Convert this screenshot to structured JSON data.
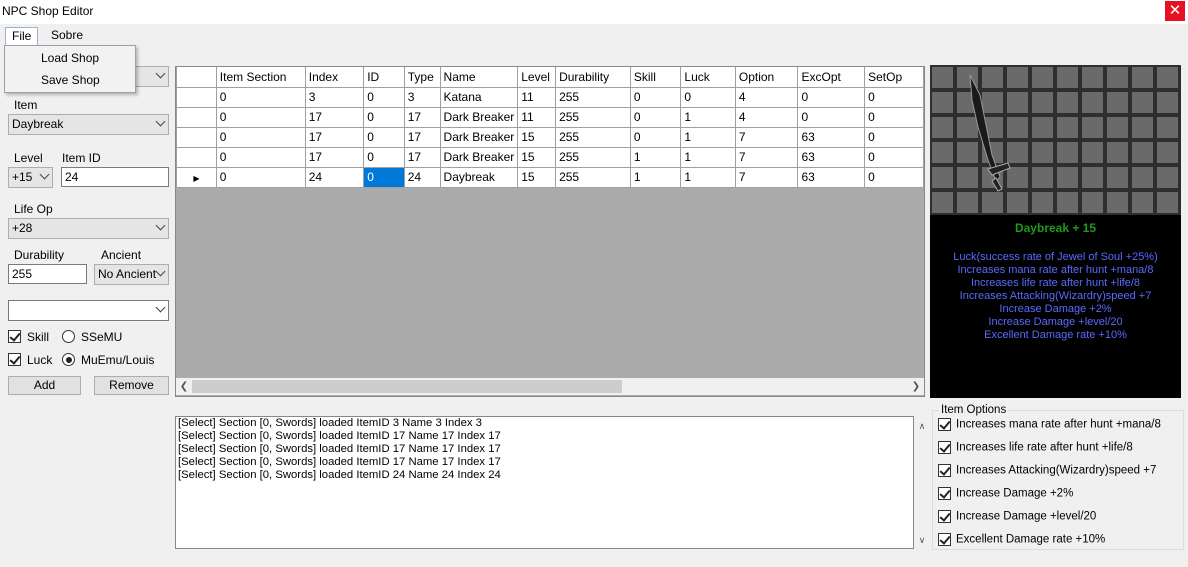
{
  "window": {
    "title": "NPC Shop Editor",
    "close_glyph": "✕"
  },
  "menu": {
    "file": "File",
    "sobre": "Sobre",
    "file_items": [
      "Load Shop",
      "Save Shop"
    ]
  },
  "left": {
    "item_label": "Item",
    "item_value": "Daybreak",
    "level_label": "Level",
    "level_value": "+15",
    "item_id_label": "Item ID",
    "item_id_value": "24",
    "life_op_label": "Life Op",
    "life_op_value": "+28",
    "durability_label": "Durability",
    "durability_value": "255",
    "ancient_label": "Ancient",
    "ancient_value": "No Ancient",
    "empty_combo_value": "",
    "skill_label": "Skill",
    "skill_checked": true,
    "luck_label": "Luck",
    "luck_checked": true,
    "radio_ssemu": "SSeMU",
    "radio_muemu": "MuEmu/Louis",
    "selected_radio": "MuEmu/Louis",
    "add_button": "Add",
    "remove_button": "Remove"
  },
  "grid": {
    "columns": [
      "Item Section",
      "Index",
      "ID",
      "Type",
      "Name",
      "Level",
      "Durability",
      "Skill",
      "Luck",
      "Option",
      "ExcOpt",
      "SetOp"
    ],
    "rows": [
      [
        "0",
        "3",
        "0",
        "3",
        "Katana",
        "11",
        "255",
        "0",
        "0",
        "4",
        "0",
        "0"
      ],
      [
        "0",
        "17",
        "0",
        "17",
        "Dark Breaker",
        "11",
        "255",
        "0",
        "1",
        "4",
        "0",
        "0"
      ],
      [
        "0",
        "17",
        "0",
        "17",
        "Dark Breaker",
        "15",
        "255",
        "0",
        "1",
        "7",
        "63",
        "0"
      ],
      [
        "0",
        "17",
        "0",
        "17",
        "Dark Breaker",
        "15",
        "255",
        "1",
        "1",
        "7",
        "63",
        "0"
      ],
      [
        "0",
        "24",
        "0",
        "24",
        "Daybreak",
        "15",
        "255",
        "1",
        "1",
        "7",
        "63",
        "0"
      ]
    ],
    "current_row": 4,
    "selected_cell": [
      4,
      2
    ],
    "row_pointer_glyph": "▶"
  },
  "preview": {
    "item_name": "Daybreak + 15",
    "lines": [
      "Luck(success rate of Jewel of Soul +25%)",
      "Increases mana rate after hunt +mana/8",
      "Increases life rate after hunt +life/8",
      "Increases Attacking(Wizardry)speed +7",
      "Increase Damage +2%",
      "Increase Damage +level/20",
      "Excellent Damage rate +10%"
    ],
    "name_color": "#1c9b1c",
    "text_color": "#5a69ff"
  },
  "log": {
    "lines": [
      "[Select] Section [0, Swords] loaded ItemID 3 Name 3 Index 3",
      "[Select] Section [0, Swords] loaded ItemID 17 Name 17 Index 17",
      "[Select] Section [0, Swords] loaded ItemID 17 Name 17 Index 17",
      "[Select] Section [0, Swords] loaded ItemID 17 Name 17 Index 17",
      "[Select] Section [0, Swords] loaded ItemID 24 Name 24 Index 24"
    ]
  },
  "item_options": {
    "title": "Item Options",
    "options": [
      {
        "label": "Increases mana rate after hunt +mana/8",
        "checked": true
      },
      {
        "label": "Increases life rate after hunt +life/8",
        "checked": true
      },
      {
        "label": "Increases Attacking(Wizardry)speed +7",
        "checked": true
      },
      {
        "label": "Increase Damage +2%",
        "checked": true
      },
      {
        "label": "Increase Damage +level/20",
        "checked": true
      },
      {
        "label": "Excellent Damage rate +10%",
        "checked": true
      }
    ]
  },
  "icons": {
    "close": "close-icon",
    "combo_arrow": "chevron-down-icon",
    "scroll_left": "chevron-left-icon",
    "scroll_right": "chevron-right-icon",
    "scroll_down": "chevron-down-icon",
    "row_pointer": "row-pointer-icon"
  }
}
